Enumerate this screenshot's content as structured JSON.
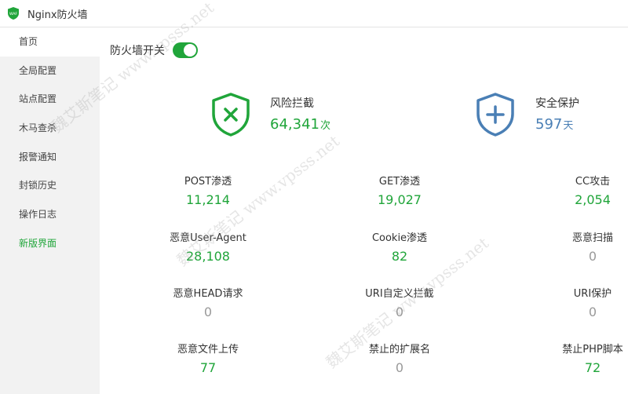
{
  "app": {
    "title": "Nginx防火墙",
    "logo_text": "WAF"
  },
  "sidebar": {
    "items": [
      {
        "label": "首页"
      },
      {
        "label": "全局配置"
      },
      {
        "label": "站点配置"
      },
      {
        "label": "木马查杀"
      },
      {
        "label": "报警通知"
      },
      {
        "label": "封锁历史"
      },
      {
        "label": "操作日志"
      },
      {
        "label": "新版界面"
      }
    ]
  },
  "firewall": {
    "switch_label": "防火墙开关",
    "enabled": true
  },
  "summary": {
    "risk": {
      "label": "风险拦截",
      "value": "64,341",
      "unit": "次",
      "icon": "shield-x-icon",
      "color": "#20a53a"
    },
    "safe": {
      "label": "安全保护",
      "value": "597",
      "unit": "天",
      "icon": "shield-plus-icon",
      "color": "#4a7fb5"
    }
  },
  "stats": [
    {
      "label": "POST渗透",
      "value": "11,214"
    },
    {
      "label": "GET渗透",
      "value": "19,027"
    },
    {
      "label": "CC攻击",
      "value": "2,054"
    },
    {
      "label": "恶意User-Agent",
      "value": "28,108"
    },
    {
      "label": "Cookie渗透",
      "value": "82"
    },
    {
      "label": "恶意扫描",
      "value": "0"
    },
    {
      "label": "恶意HEAD请求",
      "value": "0"
    },
    {
      "label": "URI自定义拦截",
      "value": "0"
    },
    {
      "label": "URI保护",
      "value": "0"
    },
    {
      "label": "恶意文件上传",
      "value": "77"
    },
    {
      "label": "禁止的扩展名",
      "value": "0"
    },
    {
      "label": "禁止PHP脚本",
      "value": "72"
    }
  ],
  "watermark": "魏艾斯笔记 www.vpsss.net"
}
